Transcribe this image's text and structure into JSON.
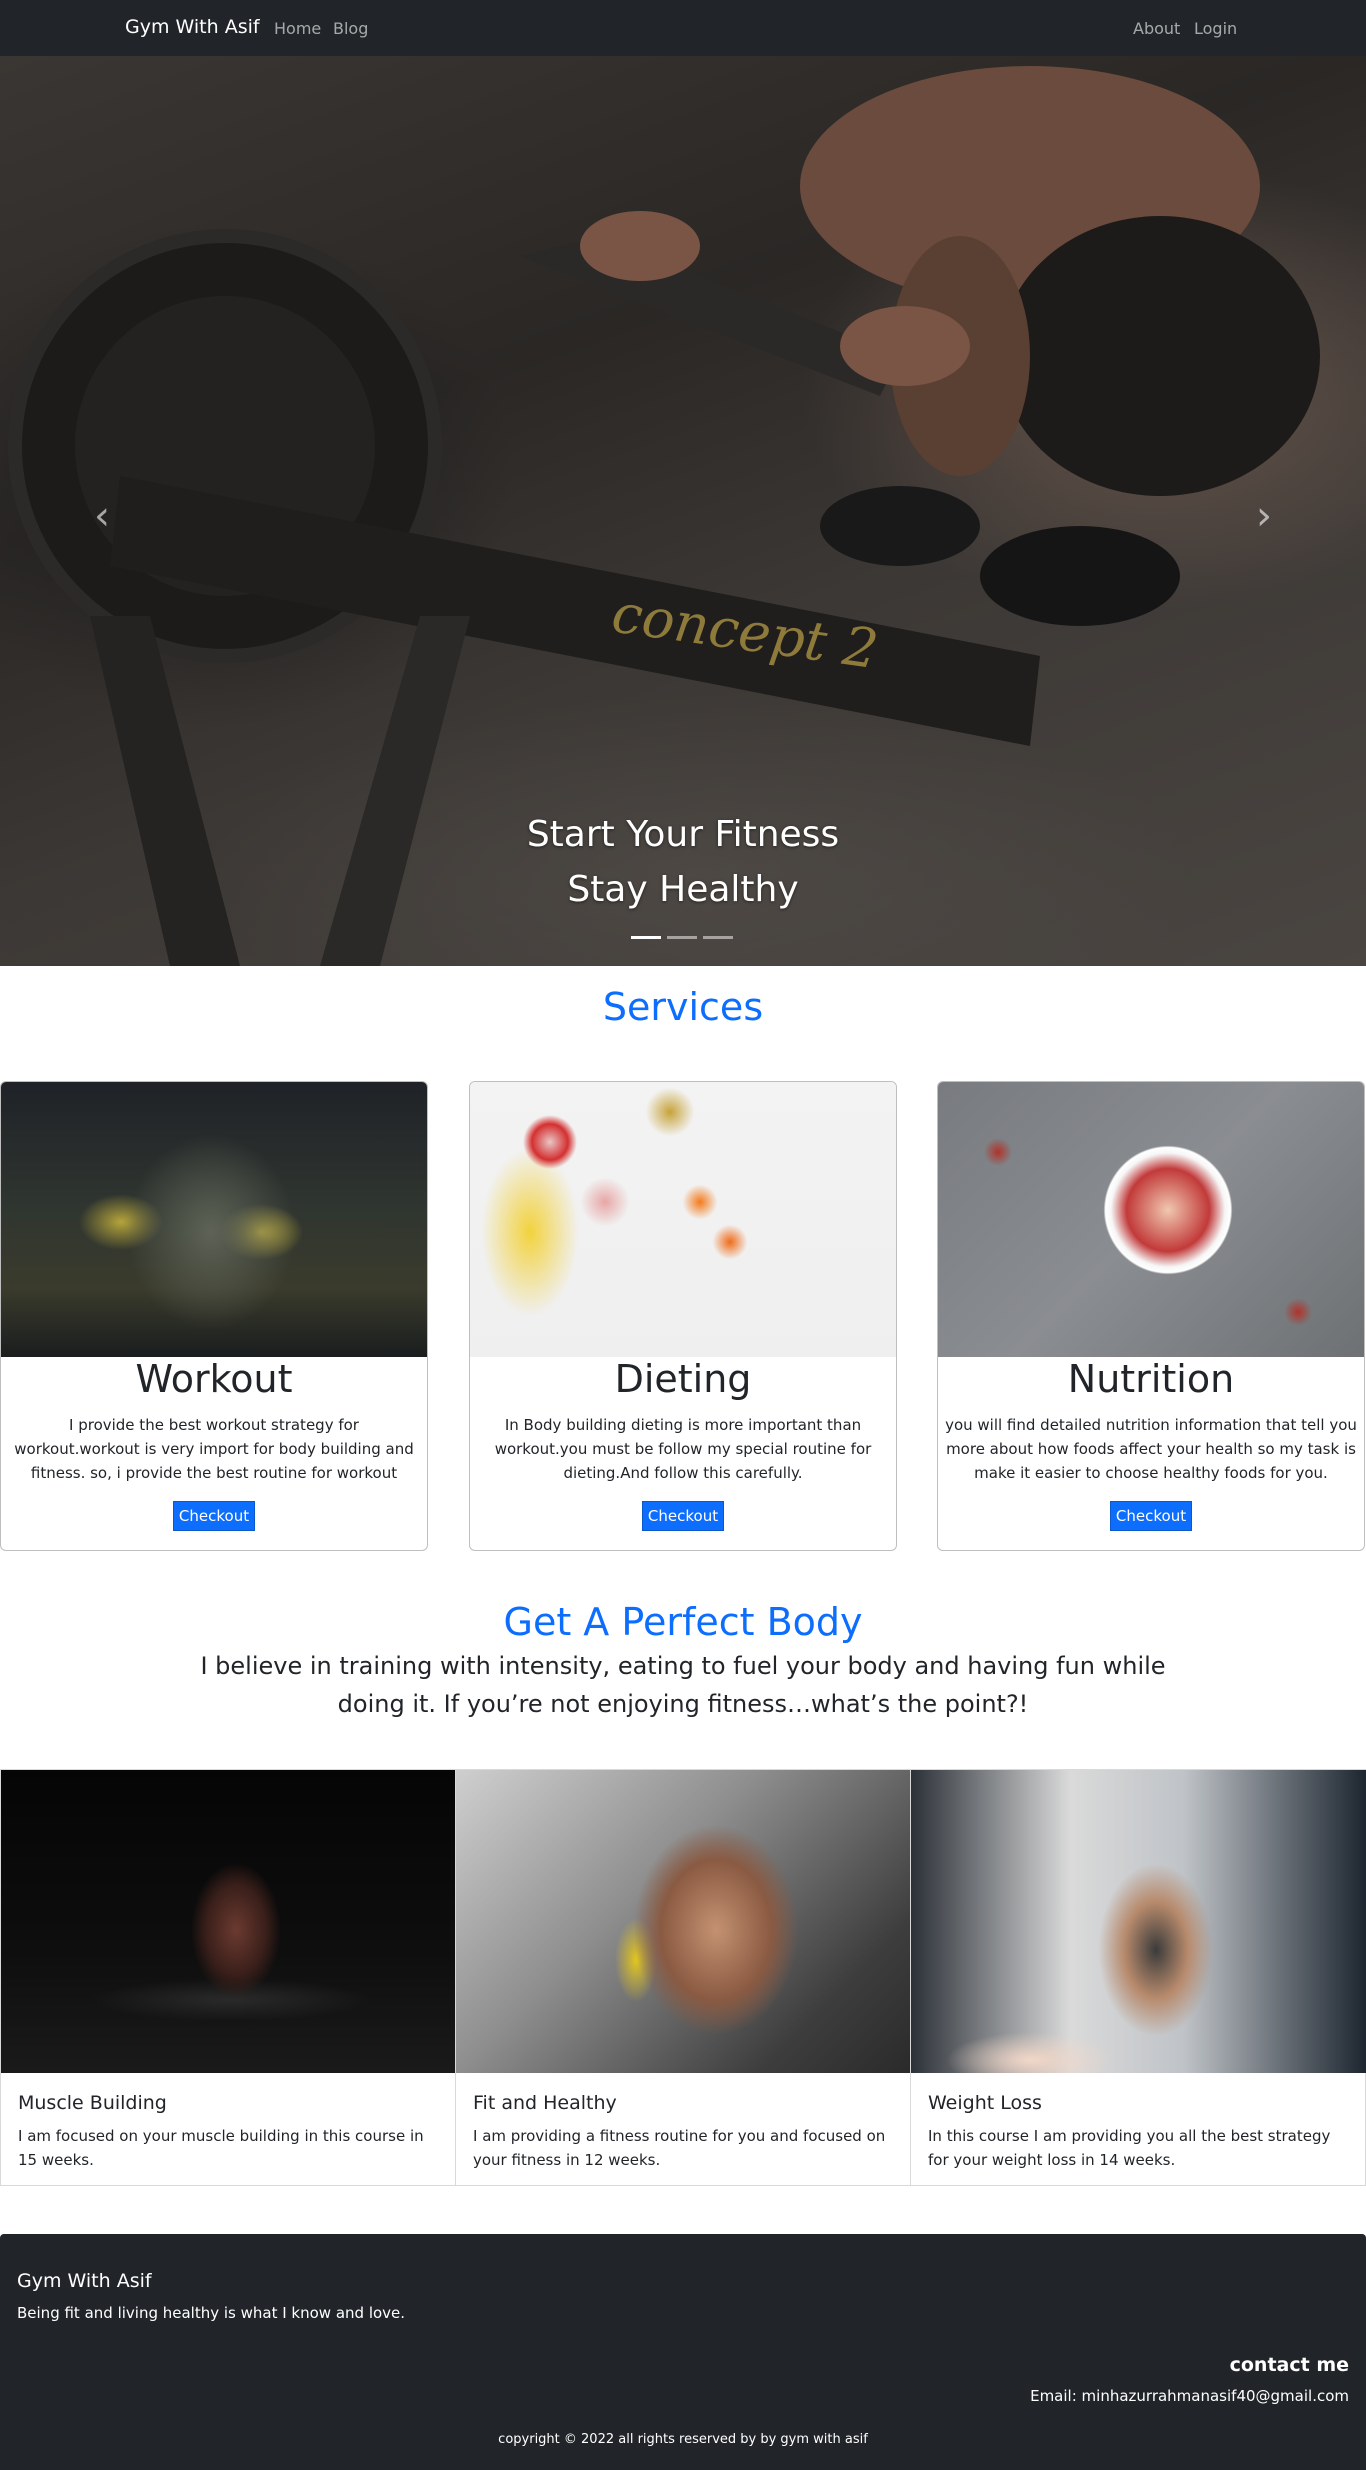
{
  "navbar": {
    "brand": "Gym With Asif",
    "links": [
      {
        "label": "Home"
      },
      {
        "label": "Blog"
      },
      {
        "label": "About"
      },
      {
        "label": "Login"
      }
    ]
  },
  "hero": {
    "caption_line1": "Start Your Fitness",
    "caption_line2": "Stay Healthy",
    "prev_icon": "chevron-left-icon",
    "next_icon": "chevron-right-icon",
    "prev_glyph": "‹",
    "next_glyph": "›",
    "slide_count": 3,
    "active_slide": 1
  },
  "services": {
    "title": "Services",
    "cards": [
      {
        "title": "Workout",
        "text": "I provide the best workout strategy for workout.workout is very import for body building and fitness. so, i provide the best routine for workout",
        "button": "Checkout"
      },
      {
        "title": "Dieting",
        "text": "In Body building dieting is more important than workout.you must be follow my special routine for dieting.And follow this carefully.",
        "button": "Checkout"
      },
      {
        "title": "Nutrition",
        "text": "you will find detailed nutrition information that tell you more about how foods affect your health so my task is make it easier to choose healthy foods for you.",
        "button": "Checkout"
      }
    ]
  },
  "perfect_body": {
    "title": "Get A Perfect Body",
    "quote": "I believe in training with intensity, eating to fuel your body and having fun while doing it. If you’re not enjoying fitness…what’s the point?!"
  },
  "courses": [
    {
      "title": "Muscle Building",
      "text": "I am focused on your muscle building in this course in 15 weeks."
    },
    {
      "title": "Fit and Healthy",
      "text": "I am providing a fitness routine for you and focused on your fitness in 12 weeks."
    },
    {
      "title": "Weight Loss",
      "text": "In this course I am providing you all the best strategy for your weight loss in 14 weeks."
    }
  ],
  "footer": {
    "brand": "Gym With Asif",
    "tagline": "Being fit and living healthy is what I know and love.",
    "contact_title": "contact me",
    "email_label": "Email: ",
    "email": "minhazurrahmanasif40@gmail.com",
    "copyright": "copyright © 2022 all rights reserved by by gym with asif"
  },
  "colors": {
    "navbar_bg": "#212529",
    "primary": "#0d6efd",
    "footer_bg": "#212529"
  }
}
